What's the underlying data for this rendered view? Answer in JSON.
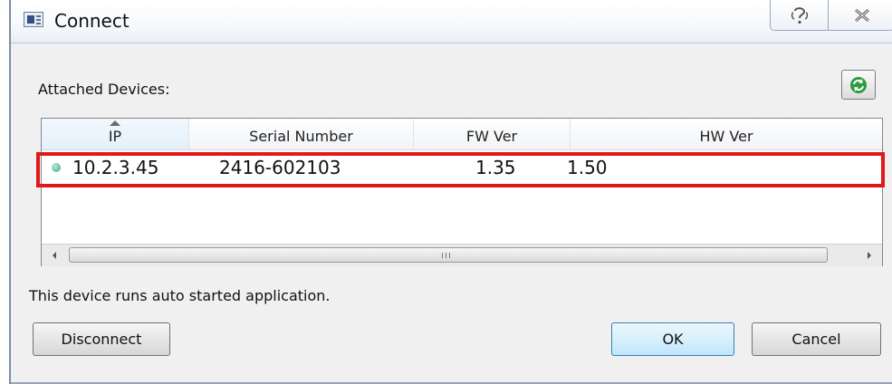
{
  "window": {
    "title": "Connect",
    "icon": "app-window-icon"
  },
  "titlebar_buttons": {
    "help_icon": "help-icon",
    "close_icon": "close-icon"
  },
  "devices": {
    "label": "Attached Devices:",
    "refresh_icon": "refresh-icon",
    "columns": [
      "IP",
      "Serial Number",
      "FW Ver",
      "HW Ver"
    ],
    "sorted_column": "IP",
    "rows": [
      {
        "status": "connected",
        "ip": "10.2.3.45",
        "serial": "2416-602103",
        "fw": "1.35",
        "hw": "1.50"
      }
    ],
    "highlight_color": "#e01818"
  },
  "status_text": "This device runs auto started application.",
  "buttons": {
    "disconnect": "Disconnect",
    "ok": "OK",
    "cancel": "Cancel"
  },
  "colors": {
    "status_dot": "#3aa57f",
    "default_button_border": "#3c7fb1"
  }
}
